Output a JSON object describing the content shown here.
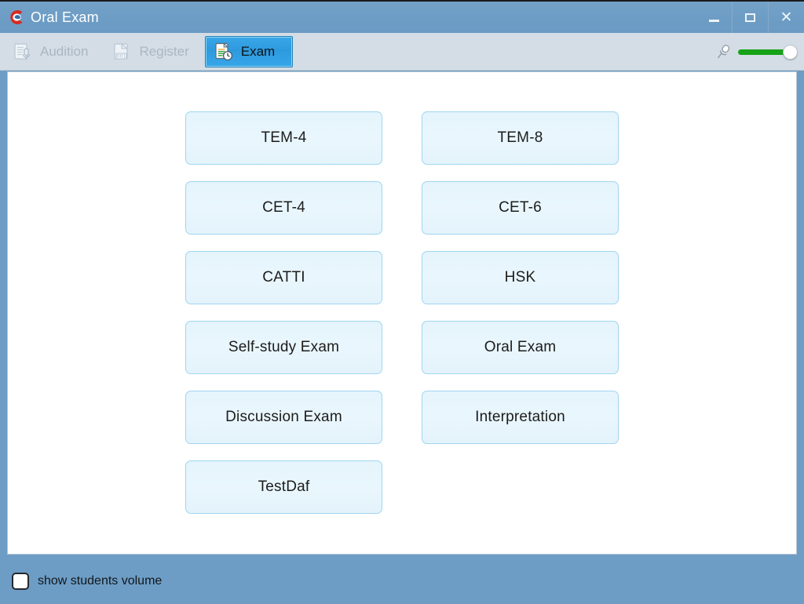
{
  "window": {
    "title": "Oral Exam",
    "icon": "app-logo-icon",
    "controls": [
      {
        "name": "minimize",
        "glyph": "minimize-icon"
      },
      {
        "name": "maximize",
        "glyph": "maximize-icon"
      },
      {
        "name": "close",
        "glyph": "close-icon",
        "label": "✕"
      }
    ]
  },
  "toolbar": {
    "tabs": [
      {
        "label": "Audition",
        "icon": "document-microphone-icon",
        "state": "disabled"
      },
      {
        "label": "Register",
        "icon": "document-number-001-icon",
        "state": "disabled"
      },
      {
        "label": "Exam",
        "icon": "document-clock-icon",
        "state": "active"
      }
    ],
    "volume": {
      "icon": "microphone-icon",
      "level": 100,
      "track_color": "#16a317"
    }
  },
  "main": {
    "columns": [
      {
        "buttons": [
          {
            "label": "TEM-4"
          },
          {
            "label": "CET-4"
          },
          {
            "label": "CATTI"
          },
          {
            "label": "Self-study Exam"
          },
          {
            "label": "Discussion Exam"
          },
          {
            "label": "TestDaf"
          }
        ]
      },
      {
        "buttons": [
          {
            "label": "TEM-8"
          },
          {
            "label": "CET-6"
          },
          {
            "label": "HSK"
          },
          {
            "label": "Oral Exam"
          },
          {
            "label": "Interpretation"
          }
        ]
      }
    ]
  },
  "footer": {
    "checkbox_label": "show students volume",
    "checkbox_checked": false
  },
  "colors": {
    "titlebar": "#6d9dc5",
    "toolbar": "#d4dde5",
    "active_tab": "#2e9ade",
    "button_fill": "#e9f6fd",
    "button_border": "#9fd6ef",
    "volume_green": "#16a317"
  }
}
